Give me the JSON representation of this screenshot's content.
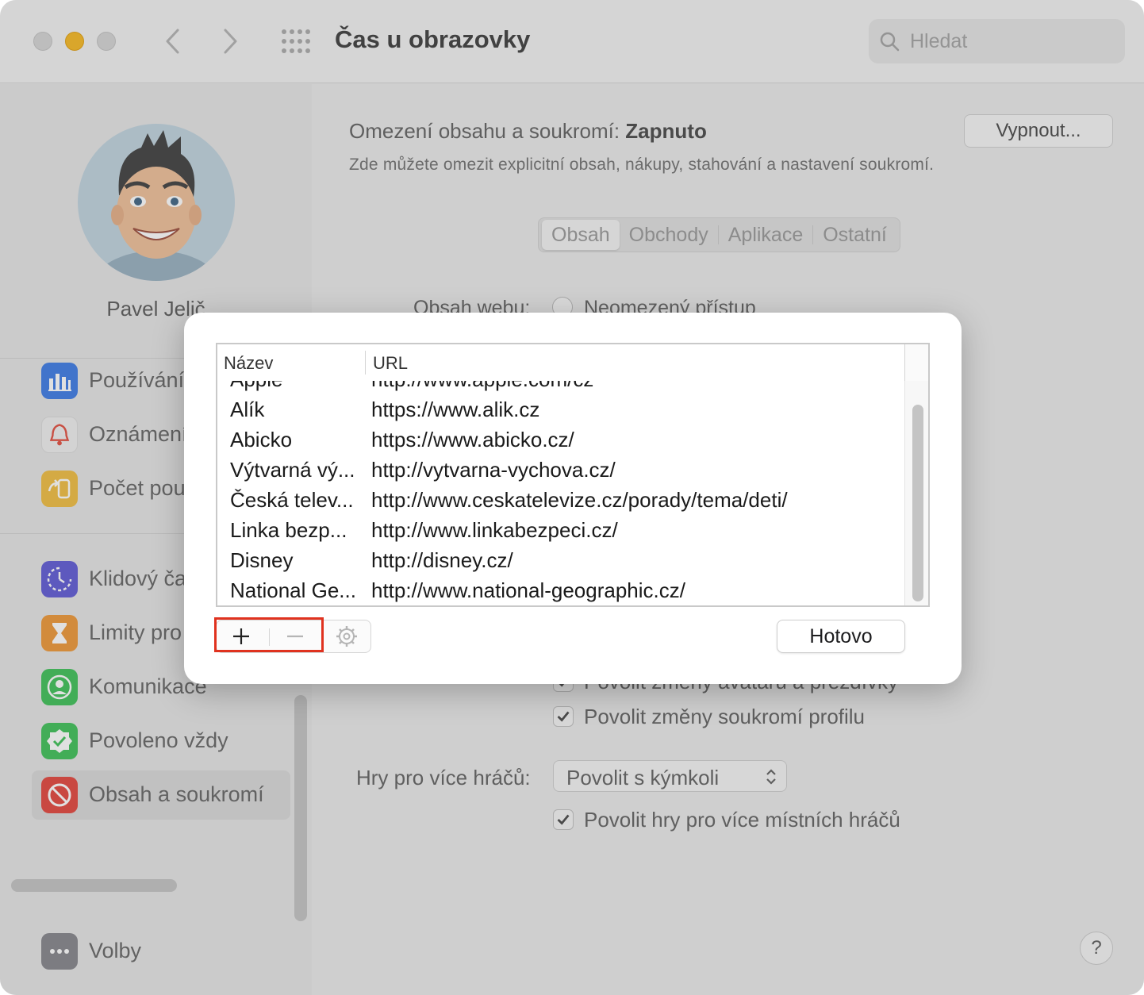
{
  "window": {
    "title": "Čas u obrazovky",
    "search_placeholder": "Hledat"
  },
  "sidebar": {
    "user_name": "Pavel Jelič",
    "items": [
      {
        "label": "Používání",
        "icon": "bar-chart-icon",
        "color": "#3b82f6"
      },
      {
        "label": "Oznámení",
        "icon": "bell-icon",
        "color": "#ef4444"
      },
      {
        "label": "Počet pou",
        "icon": "pickups-icon",
        "color": "#f5b82e"
      },
      {
        "label": "Klidový ča",
        "icon": "downtime-icon",
        "color": "#6366f1"
      },
      {
        "label": "Limity pro",
        "icon": "hourglass-icon",
        "color": "#f59e0b"
      },
      {
        "label": "Komunikace",
        "icon": "person-circle-icon",
        "color": "#22c55e"
      },
      {
        "label": "Povoleno vždy",
        "icon": "checkmark-seal-icon",
        "color": "#22c55e"
      },
      {
        "label": "Obsah a soukromí",
        "icon": "prohibited-icon",
        "color": "#ef4444"
      },
      {
        "label": "Volby",
        "icon": "ellipsis-icon",
        "color": "#8e8e93"
      }
    ]
  },
  "main": {
    "restriction_label": "Omezení obsahu a soukromí:",
    "restriction_state": "Zapnuto",
    "restriction_description": "Zde můžete omezit explicitní obsah, nákupy, stahování a nastavení soukromí.",
    "turn_off_button": "Vypnout...",
    "tabs": [
      "Obsah",
      "Obchody",
      "Aplikace",
      "Ostatní"
    ],
    "web_content_label": "Obsah webu:",
    "web_content_option": "Neomezený přístup",
    "checkbox_partial": "Povolit změny avataru a přezdívky",
    "checkbox_privacy": "Povolit změny soukromí profilu",
    "multiplayer_label": "Hry pro více hráčů:",
    "multiplayer_value": "Povolit s kýmkoli",
    "checkbox_local": "Povolit hry pro více místních hráčů",
    "help_label": "?"
  },
  "sheet": {
    "columns": [
      "Název",
      "URL"
    ],
    "rows": [
      {
        "name": "Apple",
        "url": "http://www.apple.com/cz"
      },
      {
        "name": "Alík",
        "url": "https://www.alik.cz"
      },
      {
        "name": "Abicko",
        "url": "https://www.abicko.cz/"
      },
      {
        "name": "Výtvarná vý...",
        "url": "http://vytvarna-vychova.cz/"
      },
      {
        "name": "Česká telev...",
        "url": "http://www.ceskatelevize.cz/porady/tema/deti/"
      },
      {
        "name": "Linka bezp...",
        "url": "http://www.linkabezpeci.cz/"
      },
      {
        "name": "Disney",
        "url": "http://disney.cz/"
      },
      {
        "name": "National Ge...",
        "url": "http://www.national-geographic.cz/"
      }
    ],
    "add_label": "+",
    "remove_label": "—",
    "done_button": "Hotovo"
  }
}
